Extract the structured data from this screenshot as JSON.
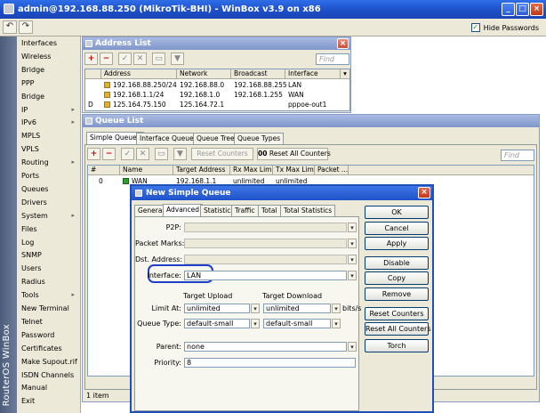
{
  "app": {
    "title": "admin@192.168.88.250 (MikroTik-BHI) - WinBox v3.9 on x86",
    "hide_passwords": "Hide Passwords",
    "brand": "RouterOS WinBox"
  },
  "menu": [
    {
      "label": "Interfaces",
      "arrow": false
    },
    {
      "label": "Wireless",
      "arrow": false
    },
    {
      "label": "Bridge",
      "arrow": false
    },
    {
      "label": "PPP",
      "arrow": false
    },
    {
      "label": "Bridge",
      "arrow": false
    },
    {
      "label": "IP",
      "arrow": true
    },
    {
      "label": "IPv6",
      "arrow": true
    },
    {
      "label": "MPLS",
      "arrow": false
    },
    {
      "label": "VPLS",
      "arrow": false
    },
    {
      "label": "Routing",
      "arrow": true
    },
    {
      "label": "Ports",
      "arrow": false
    },
    {
      "label": "Queues",
      "arrow": false
    },
    {
      "label": "Drivers",
      "arrow": false
    },
    {
      "label": "System",
      "arrow": true
    },
    {
      "label": "Files",
      "arrow": false
    },
    {
      "label": "Log",
      "arrow": false
    },
    {
      "label": "SNMP",
      "arrow": false
    },
    {
      "label": "Users",
      "arrow": false
    },
    {
      "label": "Radius",
      "arrow": false
    },
    {
      "label": "Tools",
      "arrow": true
    },
    {
      "label": "New Terminal",
      "arrow": false
    },
    {
      "label": "Telnet",
      "arrow": false
    },
    {
      "label": "Password",
      "arrow": false
    },
    {
      "label": "Certificates",
      "arrow": false
    },
    {
      "label": "Make Supout.rif",
      "arrow": false
    },
    {
      "label": "ISDN Channels",
      "arrow": false
    },
    {
      "label": "Manual",
      "arrow": false
    },
    {
      "label": "Exit",
      "arrow": false
    }
  ],
  "address_list": {
    "title": "Address List",
    "find_placeholder": "Find",
    "columns": [
      "Address",
      "Network",
      "Broadcast",
      "Interface"
    ],
    "rows": [
      {
        "flag": "",
        "address": "192.168.88.250/24",
        "network": "192.168.88.0",
        "broadcast": "192.168.88.255",
        "interface": "LAN"
      },
      {
        "flag": "",
        "address": "192.168.1.1/24",
        "network": "192.168.1.0",
        "broadcast": "192.168.1.255",
        "interface": "WAN"
      },
      {
        "flag": "D",
        "address": "125.164.75.150",
        "network": "125.164.72.1",
        "broadcast": "",
        "interface": "pppoe-out1"
      }
    ]
  },
  "queue_list": {
    "title": "Queue List",
    "tabs": [
      "Simple Queues",
      "Interface Queues",
      "Queue Tree",
      "Queue Types"
    ],
    "reset_counters": "Reset Counters",
    "reset_all_counters": "Reset All Counters",
    "reset_all_icon": "00",
    "find_placeholder": "Find",
    "columns": [
      "#",
      "Name",
      "Target Address",
      "Rx Max Limit",
      "Tx Max Limit",
      "Packet ..."
    ],
    "rows": [
      {
        "num": "0",
        "name": "WAN",
        "target": "192.168.1.1",
        "rx": "unlimited",
        "tx": "unlimited",
        "packet": ""
      }
    ],
    "footer": "1 item"
  },
  "dialog": {
    "title": "New Simple Queue",
    "tabs": [
      "General",
      "Advanced",
      "Statistics",
      "Traffic",
      "Total",
      "Total Statistics"
    ],
    "active_tab": "Advanced",
    "fields": {
      "p2p_label": "P2P:",
      "p2p_value": "",
      "packet_marks_label": "Packet Marks:",
      "packet_marks_value": "",
      "dst_address_label": "Dst. Address:",
      "dst_address_value": "",
      "interface_label": "Interface:",
      "interface_value": "LAN",
      "target_upload": "Target Upload",
      "target_download": "Target Download",
      "limit_at_label": "Limit At:",
      "limit_at_up": "unlimited",
      "limit_at_down": "unlimited",
      "unit": "bits/s",
      "queue_type_label": "Queue Type:",
      "queue_type_up": "default-small",
      "queue_type_down": "default-small",
      "parent_label": "Parent:",
      "parent_value": "none",
      "priority_label": "Priority:",
      "priority_value": "8"
    },
    "buttons": [
      "OK",
      "Cancel",
      "Apply",
      "Disable",
      "Copy",
      "Remove",
      "Reset Counters",
      "Reset All Counters",
      "Torch"
    ],
    "highlight_color": "#1f3fc8"
  }
}
